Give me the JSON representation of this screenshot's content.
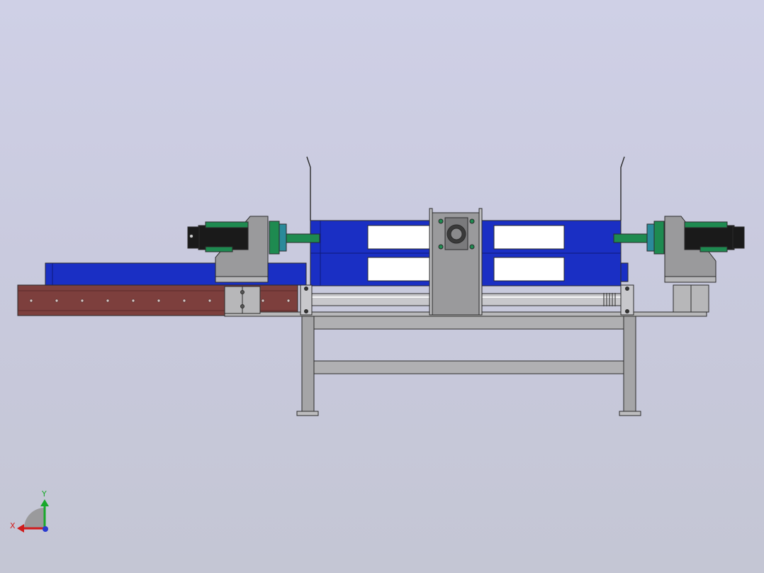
{
  "view": {
    "colors": {
      "background_top": "#cfd0e6",
      "background_bottom": "#c4c6d4",
      "frame_gray": "#a5a5a7",
      "panel_gray": "#9a9a9c",
      "carriage_blue": "#1a2fc4",
      "rail_brown": "#7d3f3d",
      "cylinder_green": "#1e8a50",
      "motor_black": "#1a1a1a",
      "shaft_silver": "#c8c8cc"
    }
  },
  "triad": {
    "x_label": "X",
    "y_label": "Y",
    "x_color": "#d01c1c",
    "y_color": "#18a82a",
    "z_color": "#2a3ad0"
  }
}
